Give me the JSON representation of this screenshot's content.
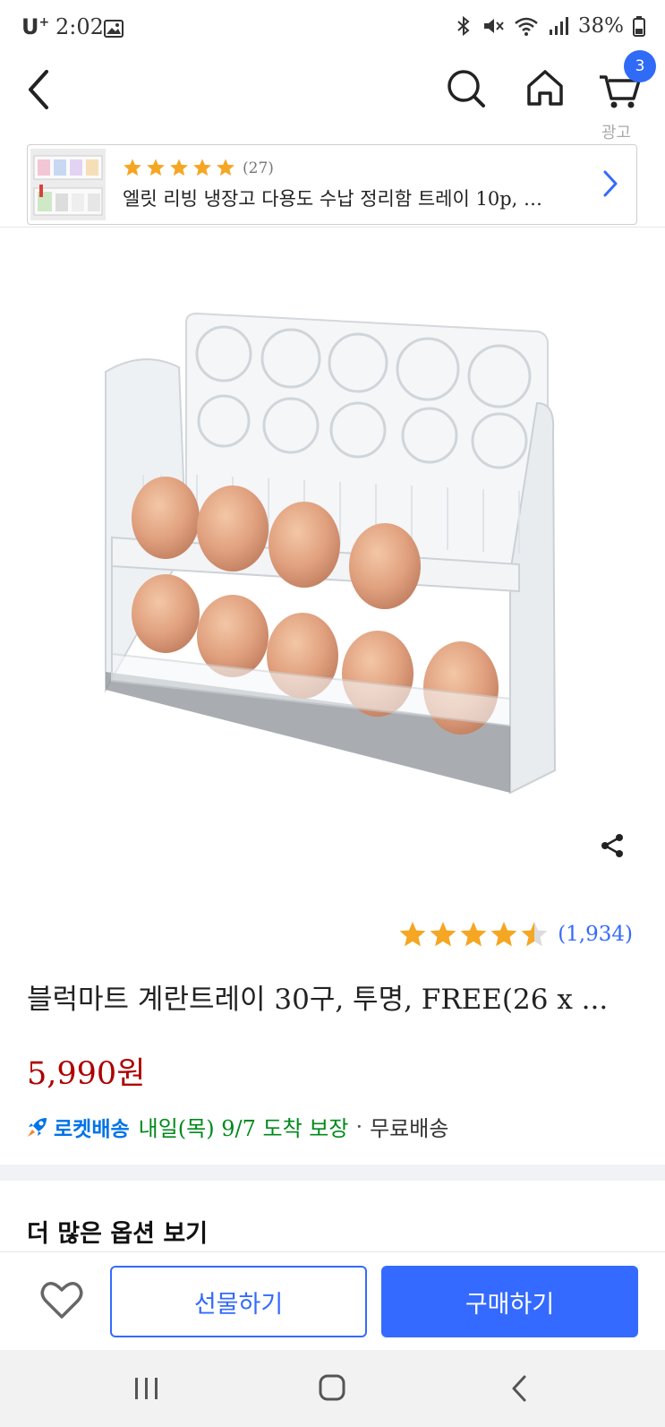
{
  "status_bar": {
    "carrier": "U",
    "carrier_sup": "+",
    "time": "2:02",
    "battery": "38%"
  },
  "nav": {
    "cart_count": "3",
    "ad_label": "광고"
  },
  "ad": {
    "rating_count": "(27)",
    "stars": 5,
    "title": "엘릿 리빙 냉장고 다용도 수납 정리함 트레이 10p, …"
  },
  "product": {
    "rating": 4.5,
    "rating_count": "(1,934)",
    "title": "블럭마트 계란트레이 30구, 투명, FREE(26 x ...",
    "price": "5,990원",
    "delivery": {
      "rocket_label": "로켓배송",
      "eta": "내일(목) 9/7 도착 보장",
      "separator": "·",
      "free_shipping": "무료배송"
    }
  },
  "more_options": "더 많은 옵션 보기",
  "actions": {
    "gift": "선물하기",
    "buy": "구매하기"
  },
  "colors": {
    "accent": "#346aff",
    "price": "#ae0000",
    "star": "#f5a623",
    "eta_green": "#00891a"
  }
}
